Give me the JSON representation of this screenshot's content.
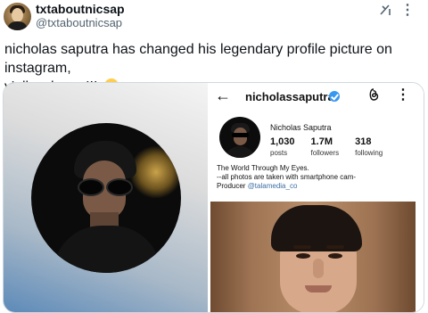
{
  "tweet": {
    "display_name": "txtaboutnicsap",
    "handle": "@txtaboutnicsap",
    "text_line1": "nicholas saputra has changed his legendary profile picture on instagram,",
    "text_line2": "y'all wake up!!!",
    "emoji": "crying-face-emoji",
    "icons": [
      "grok-icon",
      "more-icon"
    ]
  },
  "instagram": {
    "username": "nicholassaputra",
    "verified": true,
    "full_name": "Nicholas Saputra",
    "stats": [
      {
        "value": "1,030",
        "label": "posts"
      },
      {
        "value": "1.7M",
        "label": "followers"
      },
      {
        "value": "318",
        "label": "following"
      }
    ],
    "bio_line1": "The World Through My Eyes.",
    "bio_line2": "--all photos are taken with smartphone cam-",
    "bio_line3_prefix": "Producer ",
    "bio_link": "@talamedia_co",
    "verified_color": "#3897f0"
  }
}
